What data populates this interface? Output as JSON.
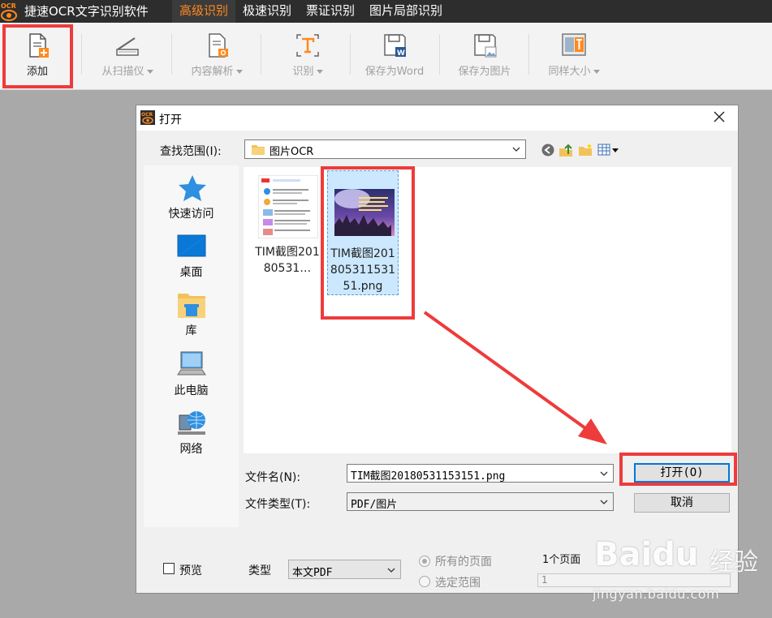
{
  "app": {
    "logo_text": "OCR",
    "title": "捷速OCR文字识别软件",
    "tabs": [
      {
        "label": "高级识别",
        "active": true
      },
      {
        "label": "极速识别",
        "active": false
      },
      {
        "label": "票证识别",
        "active": false
      },
      {
        "label": "图片局部识别",
        "active": false
      }
    ]
  },
  "toolbar": {
    "add": "添加",
    "scanner": "从扫描仪",
    "analyze": "内容解析",
    "recognize": "识别",
    "save_word": "保存为Word",
    "save_image": "保存为图片",
    "same_size": "同样大小"
  },
  "dialog": {
    "title": "打开",
    "look_in_label": "查找范围(I):",
    "look_in_value": "图片OCR",
    "places": [
      {
        "label": "快速访问",
        "icon": "star-icon"
      },
      {
        "label": "桌面",
        "icon": "desktop-icon"
      },
      {
        "label": "库",
        "icon": "library-icon"
      },
      {
        "label": "此电脑",
        "icon": "computer-icon"
      },
      {
        "label": "网络",
        "icon": "network-icon"
      }
    ],
    "files": [
      {
        "name": "TIM截图20180531…",
        "selected": false
      },
      {
        "name": "TIM截图20180531153151.png",
        "selected": true
      }
    ],
    "filename_label": "文件名(N):",
    "filename_value": "TIM截图20180531153151.png",
    "filetype_label": "文件类型(T):",
    "filetype_value": "PDF/图片",
    "open_button": "打开(O)",
    "cancel_button": "取消",
    "preview_label": "预览",
    "type_label": "类型",
    "type_value": "本文PDF",
    "all_pages_label": "所有的页面",
    "range_label": "选定范围",
    "page_count": "1个页面",
    "range_value": "1"
  },
  "watermark": {
    "logo": "Baidu",
    "cn": "经验",
    "url": "jingyan.baidu.com"
  },
  "colors": {
    "highlight_red": "#ee3b3b",
    "accent_orange": "#ff8a1f",
    "selection_blue": "#cce8ff"
  }
}
